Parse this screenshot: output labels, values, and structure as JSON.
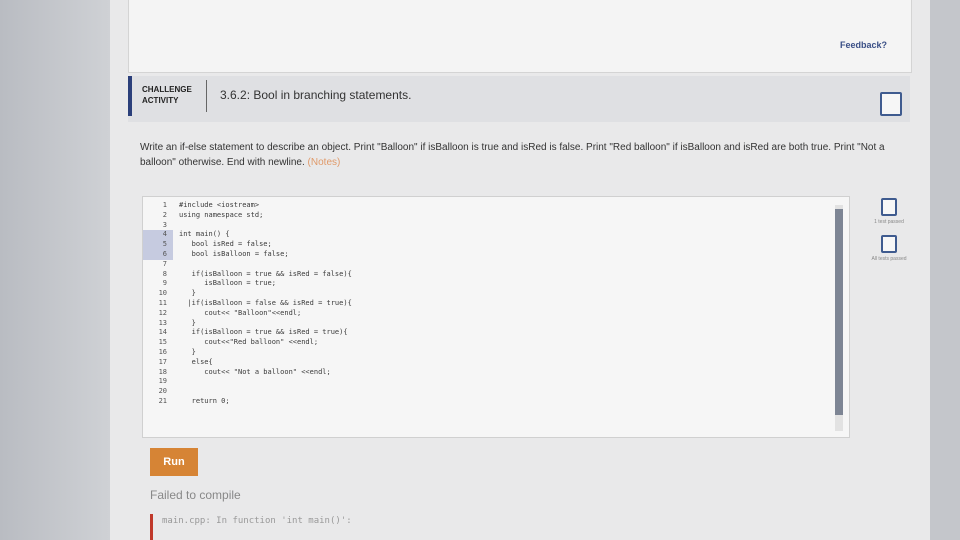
{
  "header": {
    "feedback_link": "Feedback?"
  },
  "activity": {
    "type_line1": "CHALLENGE",
    "type_line2": "ACTIVITY",
    "title": "3.6.2: Bool in branching statements."
  },
  "instructions": {
    "text": "Write an if-else statement to describe an object. Print \"Balloon\" if isBalloon is true and isRed is false. Print \"Red balloon\" if isBalloon and isRed are both true. Print \"Not a balloon\" otherwise. End with newline. ",
    "notes_link": "(Notes)"
  },
  "editor": {
    "line_numbers": [
      "1",
      "2",
      "3",
      "4",
      "5",
      "6",
      "7",
      "8",
      "9",
      "10",
      "11",
      "12",
      "13",
      "14",
      "15",
      "16",
      "17",
      "18",
      "19",
      "20",
      "21"
    ],
    "lines": [
      "#include <iostream>",
      "using namespace std;",
      "",
      "int main() {",
      "   bool isRed = false;",
      "   bool isBalloon = false;",
      "",
      "   if(isBalloon = true && isRed = false){",
      "      isBalloon = true;",
      "   }",
      "  |if(isBalloon = false && isRed = true){",
      "      cout<< \"Balloon\"<<endl;",
      "   }",
      "   if(isBalloon = true && isRed = true){",
      "      cout<<\"Red balloon\" <<endl;",
      "   }",
      "   else{",
      "      cout<< \"Not a balloon\" <<endl;",
      "",
      "",
      "   return 0;"
    ]
  },
  "tests": [
    {
      "label": "1 test passed"
    },
    {
      "label": "All tests passed"
    }
  ],
  "run_button": {
    "label": "Run"
  },
  "result": {
    "status": "Failed to compile",
    "error_output": "main.cpp: In function 'int main()':"
  },
  "colors": {
    "accent": "#2b3f7a",
    "run": "#d68435",
    "notes": "#e09a6a"
  }
}
